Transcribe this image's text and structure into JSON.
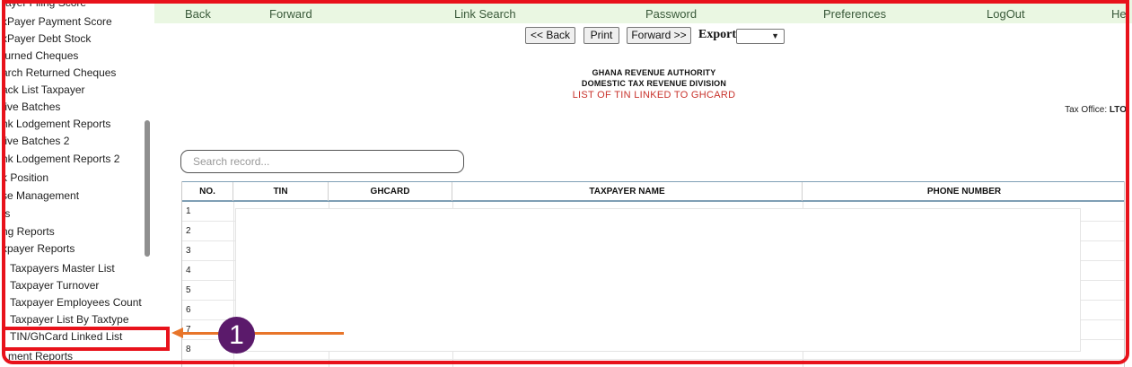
{
  "sidebar": {
    "items": [
      {
        "label": "ayer Filing Score"
      },
      {
        "label": "xPayer Payment Score"
      },
      {
        "label": "xPayer Debt Stock"
      },
      {
        "label": "turned Cheques"
      },
      {
        "label": "arch Returned Cheques"
      },
      {
        "label": "ack List Taxpayer"
      },
      {
        "label": "tive Batches"
      },
      {
        "label": "nk Lodgement Reports"
      },
      {
        "label": "tive Batches 2"
      },
      {
        "label": "nk Lodgement Reports 2"
      },
      {
        "label": "k Position"
      },
      {
        "label": "se Management"
      },
      {
        "label": "ts"
      },
      {
        "label": "ng Reports"
      },
      {
        "label": "xpayer Reports"
      },
      {
        "label": "Taxpayers Master List"
      },
      {
        "label": "Taxpayer Turnover"
      },
      {
        "label": "Taxpayer Employees Count"
      },
      {
        "label": "Taxpayer List By Taxtype"
      },
      {
        "label": "TIN/GhCard Linked List"
      },
      {
        "label": "ment Reports"
      }
    ]
  },
  "toolbar": {
    "back": "Back",
    "forward": "Forward",
    "link_search": "Link Search",
    "password": "Password",
    "preferences": "Preferences",
    "logout": "LogOut",
    "help": "He"
  },
  "nav": {
    "back": "<< Back",
    "print": "Print",
    "forward": "Forward >>",
    "export": "Export"
  },
  "report": {
    "org": "GHANA REVENUE AUTHORITY",
    "division": "DOMESTIC TAX REVENUE DIVISION",
    "title": "LIST OF TIN LINKED TO GHCARD",
    "tax_office_label": "Tax Office:",
    "tax_office_value": "LTO"
  },
  "search": {
    "placeholder": "Search record..."
  },
  "table": {
    "columns": [
      "NO.",
      "TIN",
      "GHCARD",
      "TAXPAYER NAME",
      "PHONE NUMBER"
    ],
    "rows": [
      "1",
      "2",
      "3",
      "4",
      "5",
      "6",
      "7",
      "8"
    ]
  },
  "annotation": {
    "step": "1",
    "colors": {
      "frame": "#e8121b",
      "arrow": "#e8752a",
      "badge": "#5b1a6b"
    }
  }
}
